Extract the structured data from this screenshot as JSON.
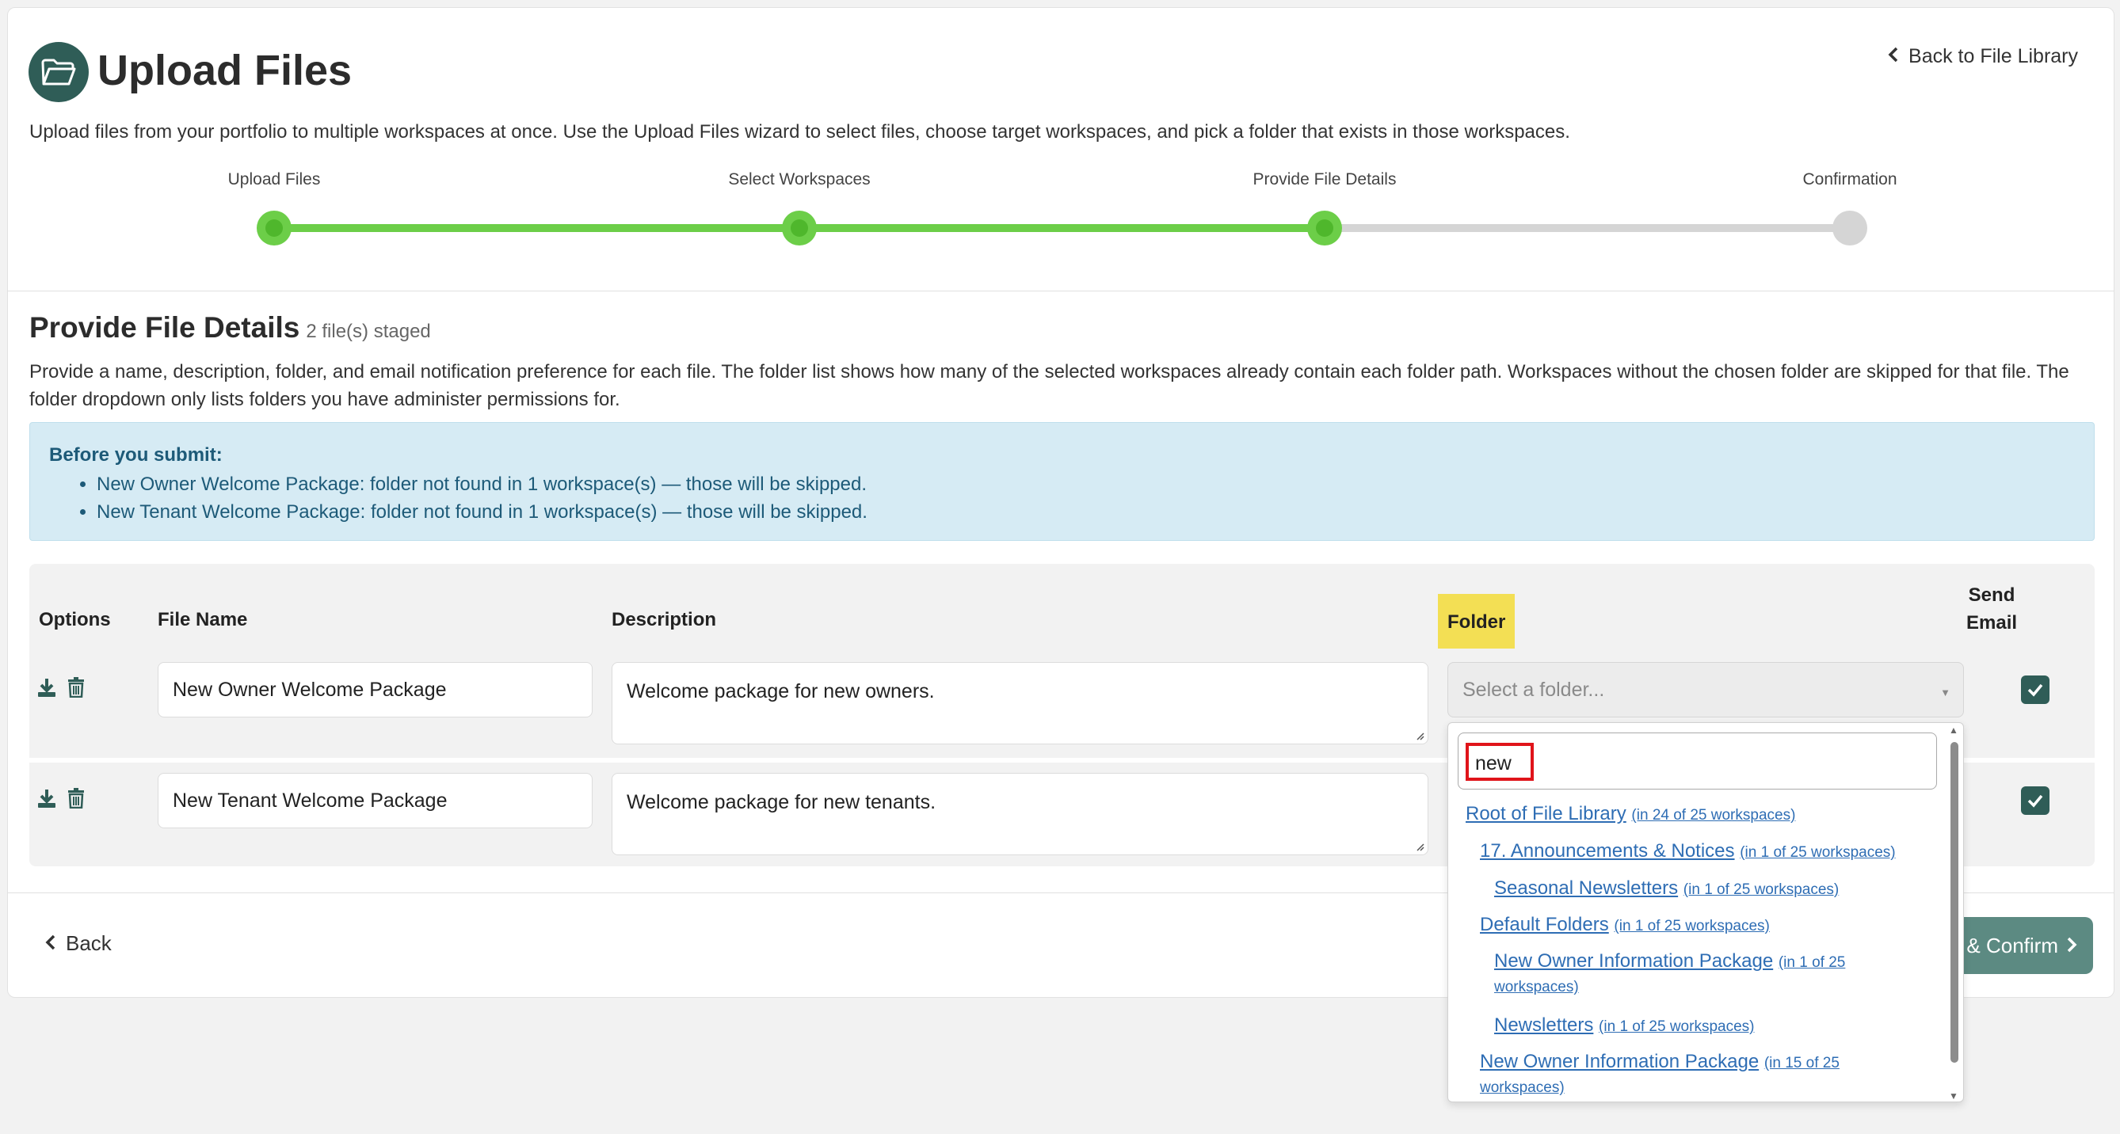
{
  "header": {
    "title": "Upload Files",
    "back_link": "Back to File Library",
    "intro": "Upload files from your portfolio to multiple workspaces at once. Use the Upload Files wizard to select files, choose target workspaces, and pick a folder that exists in those workspaces."
  },
  "stepper": {
    "steps": [
      {
        "label": "Upload Files",
        "status": "complete"
      },
      {
        "label": "Select Workspaces",
        "status": "complete"
      },
      {
        "label": "Provide File Details",
        "status": "current"
      },
      {
        "label": "Confirmation",
        "status": "pending"
      }
    ],
    "colors": {
      "complete": "#6cce48",
      "pending": "#d5d5d5"
    }
  },
  "section": {
    "title": "Provide File Details",
    "staged": "2 file(s) staged",
    "description": "Provide a name, description, folder, and email notification preference for each file. The folder list shows how many of the selected workspaces already contain each folder path. Workspaces without the chosen folder are skipped for that file. The folder dropdown only lists folders you have administer permissions for."
  },
  "alert": {
    "title": "Before you submit:",
    "items": [
      "New Owner Welcome Package: folder not found in 1 workspace(s) — those will be skipped.",
      "New Tenant Welcome Package: folder not found in 1 workspace(s) — those will be skipped."
    ]
  },
  "table": {
    "headers": {
      "options": "Options",
      "file_name": "File Name",
      "description": "Description",
      "folder": "Folder",
      "send_email_1": "Send",
      "send_email_2": "Email"
    },
    "rows": [
      {
        "file_name": "New Owner Welcome Package",
        "description": "Welcome package for new owners.",
        "folder_placeholder": "Select a folder...",
        "send_email": true
      },
      {
        "file_name": "New Tenant Welcome Package",
        "description": "Welcome package for new tenants.",
        "send_email": true
      }
    ]
  },
  "dropdown": {
    "search_value": "new",
    "items": [
      {
        "name": "Root of File Library",
        "count": "(in 24 of 25 workspaces)"
      },
      {
        "name": "17. Announcements & Notices",
        "count": "(in 1 of 25 workspaces)"
      },
      {
        "name": "Seasonal Newsletters",
        "count": "(in 1 of 25 workspaces)"
      },
      {
        "name": "Default Folders",
        "count": "(in 1 of 25 workspaces)"
      },
      {
        "name": "New Owner Information Package",
        "count": "(in 1 of 25",
        "count2": "workspaces)"
      },
      {
        "name": "Newsletters",
        "count": "(in 1 of 25 workspaces)"
      },
      {
        "name": "New Owner Information Package",
        "count": "(in 15 of 25",
        "count2": "workspaces)"
      }
    ]
  },
  "footer": {
    "back": "Back",
    "confirm": "& Confirm"
  },
  "colors": {
    "brand": "#2f5d57",
    "link": "#2e6db4",
    "highlight": "#f3df54",
    "alert_bg": "#d6ebf4"
  }
}
